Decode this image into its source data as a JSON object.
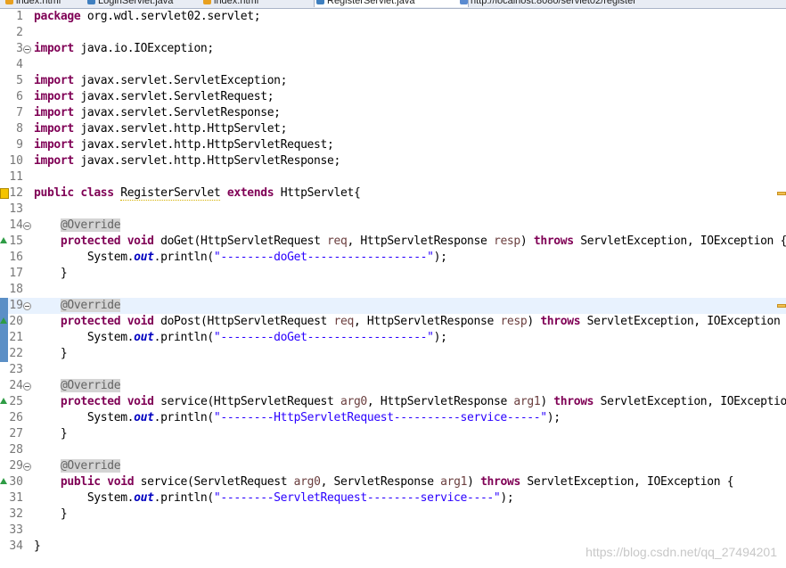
{
  "tabs": [
    {
      "label": "index.html",
      "icon": "html-file-icon",
      "color": "#e8a020"
    },
    {
      "label": "LoginServlet.java",
      "icon": "java-file-icon",
      "color": "#3f7fbf"
    },
    {
      "label": "index.html",
      "icon": "html-file-icon",
      "color": "#e8a020"
    },
    {
      "label": "RegisterServlet.java",
      "icon": "java-file-icon",
      "color": "#3f7fbf",
      "active": true
    },
    {
      "label": "http://localhost:8080/servlet02/register",
      "icon": "browser-icon",
      "color": "#5a8ad0"
    }
  ],
  "colors": {
    "keyword": "#7f0055",
    "string": "#2a00ff",
    "field": "#0000c0",
    "annotation": "#646464",
    "line_number": "#787878",
    "current_line": "#e8f2fe"
  },
  "lines": [
    [
      [
        "kw",
        "package"
      ],
      [
        "t",
        " org.wdl.servlet02.servlet;"
      ]
    ],
    [],
    [
      [
        "kw",
        "import"
      ],
      [
        "t",
        " java.io.IOException;"
      ]
    ],
    [],
    [
      [
        "kw",
        "import"
      ],
      [
        "t",
        " javax.servlet.ServletException;"
      ]
    ],
    [
      [
        "kw",
        "import"
      ],
      [
        "t",
        " javax.servlet.ServletRequest;"
      ]
    ],
    [
      [
        "kw",
        "import"
      ],
      [
        "t",
        " javax.servlet.ServletResponse;"
      ]
    ],
    [
      [
        "kw",
        "import"
      ],
      [
        "t",
        " javax.servlet.http.HttpServlet;"
      ]
    ],
    [
      [
        "kw",
        "import"
      ],
      [
        "t",
        " javax.servlet.http.HttpServletRequest;"
      ]
    ],
    [
      [
        "kw",
        "import"
      ],
      [
        "t",
        " javax.servlet.http.HttpServletResponse;"
      ]
    ],
    [],
    [
      [
        "kw",
        "public"
      ],
      [
        "t",
        " "
      ],
      [
        "kw",
        "class"
      ],
      [
        "t",
        " "
      ],
      [
        "sq",
        "RegisterServlet"
      ],
      [
        "t",
        " "
      ],
      [
        "kw",
        "extends"
      ],
      [
        "t",
        " HttpServlet{"
      ]
    ],
    [],
    [
      [
        "t",
        "    "
      ],
      [
        "ann",
        "@Override"
      ]
    ],
    [
      [
        "t",
        "    "
      ],
      [
        "kw",
        "protected"
      ],
      [
        "t",
        " "
      ],
      [
        "kw",
        "void"
      ],
      [
        "t",
        " doGet(HttpServletRequest "
      ],
      [
        "prm",
        "req"
      ],
      [
        "t",
        ", HttpServletResponse "
      ],
      [
        "prm",
        "resp"
      ],
      [
        "t",
        ") "
      ],
      [
        "kw",
        "throws"
      ],
      [
        "t",
        " ServletException, IOException {"
      ]
    ],
    [
      [
        "t",
        "        System."
      ],
      [
        "fld",
        "out"
      ],
      [
        "t",
        ".println("
      ],
      [
        "str",
        "\"--------doGet------------------\""
      ],
      [
        "t",
        ");"
      ]
    ],
    [
      [
        "t",
        "    }"
      ]
    ],
    [],
    [
      [
        "t",
        "    "
      ],
      [
        "ann",
        "@Override"
      ]
    ],
    [
      [
        "t",
        "    "
      ],
      [
        "kw",
        "protected"
      ],
      [
        "t",
        " "
      ],
      [
        "kw",
        "void"
      ],
      [
        "t",
        " doPost(HttpServletRequest "
      ],
      [
        "prm",
        "req"
      ],
      [
        "t",
        ", HttpServletResponse "
      ],
      [
        "prm",
        "resp"
      ],
      [
        "t",
        ") "
      ],
      [
        "kw",
        "throws"
      ],
      [
        "t",
        " ServletException, IOException {"
      ]
    ],
    [
      [
        "t",
        "        System."
      ],
      [
        "fld",
        "out"
      ],
      [
        "t",
        ".println("
      ],
      [
        "str",
        "\"--------doGet------------------\""
      ],
      [
        "t",
        ");"
      ]
    ],
    [
      [
        "t",
        "    }"
      ]
    ],
    [],
    [
      [
        "t",
        "    "
      ],
      [
        "ann",
        "@Override"
      ]
    ],
    [
      [
        "t",
        "    "
      ],
      [
        "kw",
        "protected"
      ],
      [
        "t",
        " "
      ],
      [
        "kw",
        "void"
      ],
      [
        "t",
        " service(HttpServletRequest "
      ],
      [
        "prm",
        "arg0"
      ],
      [
        "t",
        ", HttpServletResponse "
      ],
      [
        "prm",
        "arg1"
      ],
      [
        "t",
        ") "
      ],
      [
        "kw",
        "throws"
      ],
      [
        "t",
        " ServletException, IOException {"
      ]
    ],
    [
      [
        "t",
        "        System."
      ],
      [
        "fld",
        "out"
      ],
      [
        "t",
        ".println("
      ],
      [
        "str",
        "\"--------HttpServletRequest----------service-----\""
      ],
      [
        "t",
        ");"
      ]
    ],
    [
      [
        "t",
        "    }"
      ]
    ],
    [],
    [
      [
        "t",
        "    "
      ],
      [
        "ann",
        "@Override"
      ]
    ],
    [
      [
        "t",
        "    "
      ],
      [
        "kw",
        "public"
      ],
      [
        "t",
        " "
      ],
      [
        "kw",
        "void"
      ],
      [
        "t",
        " service(ServletRequest "
      ],
      [
        "prm",
        "arg0"
      ],
      [
        "t",
        ", ServletResponse "
      ],
      [
        "prm",
        "arg1"
      ],
      [
        "t",
        ") "
      ],
      [
        "kw",
        "throws"
      ],
      [
        "t",
        " ServletException, IOException {"
      ]
    ],
    [
      [
        "t",
        "        System."
      ],
      [
        "fld",
        "out"
      ],
      [
        "t",
        ".println("
      ],
      [
        "str",
        "\"--------ServletRequest--------service----\""
      ],
      [
        "t",
        ");"
      ]
    ],
    [
      [
        "t",
        "    }"
      ]
    ],
    [],
    [
      [
        "t",
        "}"
      ]
    ]
  ],
  "fold_lines": [
    3,
    14,
    19,
    24,
    29
  ],
  "override_lines": [
    15,
    20,
    25,
    30
  ],
  "warning_lines": [
    12
  ],
  "marked_lines": [
    19,
    20,
    21,
    22
  ],
  "current_line": 19,
  "ruler_marks": [
    12,
    19
  ],
  "watermark": "https://blog.csdn.net/qq_27494201"
}
